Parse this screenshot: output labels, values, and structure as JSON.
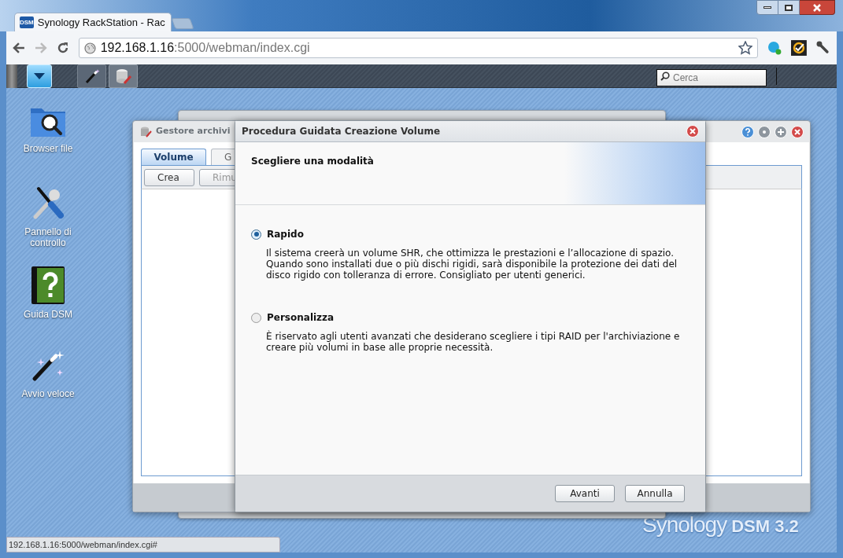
{
  "browser": {
    "favicon": "DSM",
    "tab_title": "Synology RackStation - Rac",
    "url_host": "192.168.1.16",
    "url_rest": ":5000/webman/index.cgi"
  },
  "dsm_taskbar": {
    "search_placeholder": "Cerca"
  },
  "desktop_icons": [
    {
      "label": "Browser file",
      "kind": "folder"
    },
    {
      "label": "Pannello di controllo",
      "kind": "tools"
    },
    {
      "label": "Guida DSM",
      "kind": "help"
    },
    {
      "label": "Avvio veloce",
      "kind": "wand"
    }
  ],
  "storage_window": {
    "title": "Gestore archivi",
    "tabs": [
      {
        "label": "Volume",
        "selected": true
      },
      {
        "label": "G",
        "selected": false
      }
    ],
    "buttons": [
      {
        "label": "Crea",
        "disabled": false
      },
      {
        "label": "Rimu",
        "disabled": true
      }
    ]
  },
  "wizard": {
    "title": "Procedura Guidata Creazione Volume",
    "heading": "Scegliere una modalità",
    "options": [
      {
        "label": "Rapido",
        "description": "Il sistema creerà un volume SHR, che ottimizza le prestazioni e l’allocazione di spazio. Quando sono installati due o più dischi rigidi, sarà disponibile la protezione dei dati del disco rigido con tolleranza di errore. Consigliato per utenti generici.",
        "selected": true
      },
      {
        "label": "Personalizza",
        "description": "È riservato agli utenti avanzati che desiderano scegliere i tipi RAID per l'archiviazione e creare più volumi in base alle proprie necessità.",
        "selected": false
      }
    ],
    "buttons": [
      "Avanti",
      "Annulla"
    ]
  },
  "wallpaper_logo": {
    "brand": "Synology",
    "product": "DSM 3.2"
  },
  "status_url": "192.168.1.16:5000/webman/index.cgi#"
}
